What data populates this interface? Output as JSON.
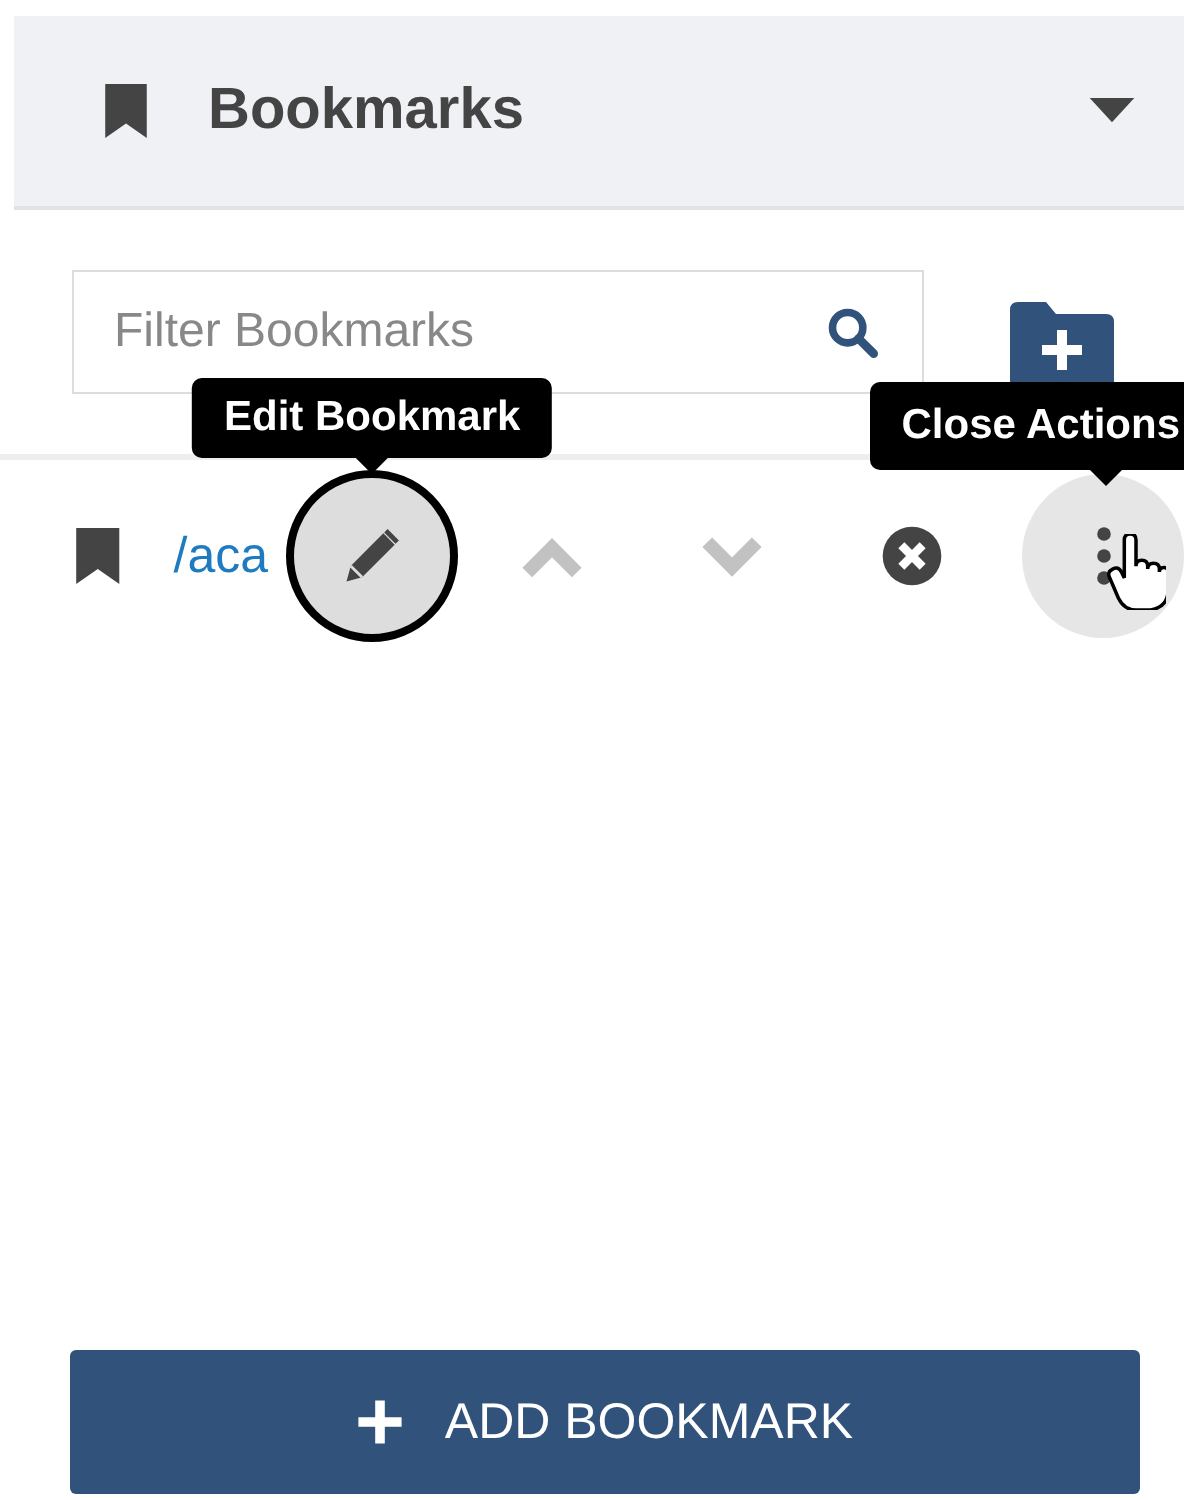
{
  "panel": {
    "title": "Bookmarks"
  },
  "filter": {
    "placeholder": "Filter Bookmarks"
  },
  "bookmarks": [
    {
      "label": "/aca",
      "actions": [
        {
          "kind": "edit",
          "disabled": false,
          "tooltip": "Edit Bookmark"
        },
        {
          "kind": "up",
          "disabled": true
        },
        {
          "kind": "down",
          "disabled": true
        },
        {
          "kind": "remove",
          "disabled": false
        },
        {
          "kind": "more",
          "disabled": false,
          "tooltip": "Close Actions"
        }
      ]
    }
  ],
  "add_button": {
    "label": "ADD BOOKMARK"
  }
}
